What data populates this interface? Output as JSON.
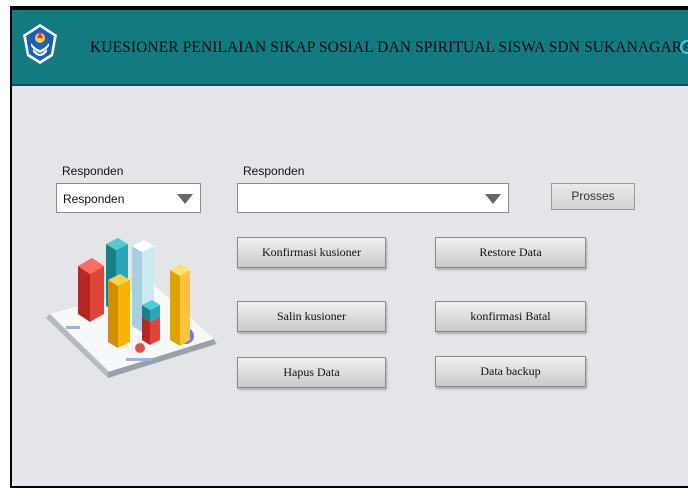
{
  "header": {
    "title": "KUESIONER PENILAIAN  SIKAP SOSIAL DAN SPIRITUAL SISWA SDN SUKANAGARA",
    "bg_color": "#137a82"
  },
  "form": {
    "left_label": "Responden",
    "left_combo_value": "Responden",
    "right_label": "Responden",
    "right_combo_value": "",
    "process_button": "Prosses"
  },
  "buttons": {
    "konfirmasi": "Konfirmasi kusioner",
    "restore": "Restore Data",
    "salin": "Salin kusioner",
    "konfirmasi_batal": "konfirmasi Batal",
    "hapus": "Hapus Data",
    "backup": "Data backup"
  },
  "icons": {
    "logo": "tut-wuri-handayani-logo",
    "illustration": "3d-bar-chart-illustration"
  }
}
